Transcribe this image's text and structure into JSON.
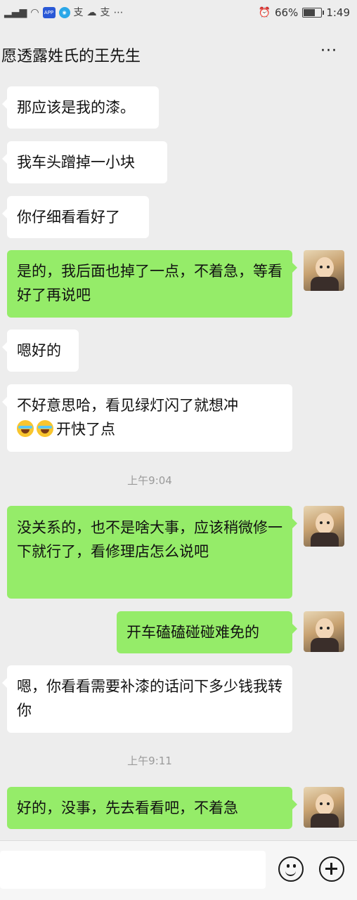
{
  "status_bar": {
    "battery": "66%",
    "battery_level": 0.66,
    "time": "1:49",
    "icons": [
      "signal-icon",
      "wifi-icon",
      "app-badge-icon",
      "location-icon",
      "alipay-icon",
      "cloud-icon",
      "alipay-icon",
      "more-icon",
      "alarm-icon",
      "battery-icon"
    ]
  },
  "header": {
    "title": "愿透露姓氏的王先生",
    "more_label": "···"
  },
  "messages": [
    {
      "side": "in",
      "text": "那应该是我的漆。"
    },
    {
      "side": "in",
      "text": "我车头蹭掉一小块"
    },
    {
      "side": "in",
      "text": "你仔细看看好了"
    },
    {
      "side": "out",
      "text": "是的，我后面也掉了一点，不着急，等看好了再说吧"
    },
    {
      "side": "in",
      "text": "嗯好的"
    },
    {
      "side": "in",
      "text": "不好意思哈，看见绿灯闪了就想冲",
      "emoji": "crying-laughing-emoji",
      "text_after": "开快了点"
    },
    {
      "time": "上午9:04"
    },
    {
      "side": "out",
      "text": "没关系的，也不是啥大事，应该稍微修一下就行了，看修理店怎么说吧"
    },
    {
      "side": "out",
      "text": "开车磕磕碰碰难免的"
    },
    {
      "side": "in",
      "text": "嗯，你看看需要补漆的话问下多少钱我转你"
    },
    {
      "time": "上午9:11"
    },
    {
      "side": "out",
      "text": "好的，没事，先去看看吧，不着急"
    }
  ],
  "colors": {
    "background": "#ededed",
    "incoming_bubble": "#ffffff",
    "outgoing_bubble": "#95ec69",
    "timestamp": "#9a9a9a"
  }
}
